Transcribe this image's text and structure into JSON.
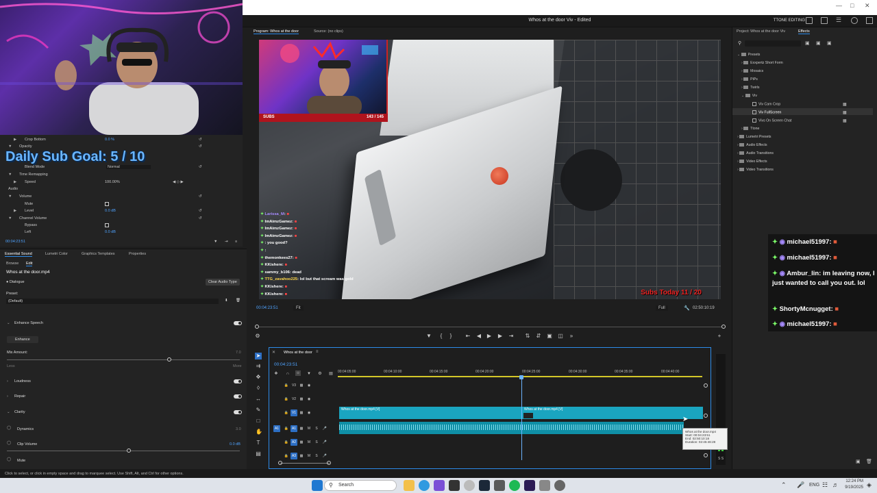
{
  "app": {
    "title": "Whos at the door Viv - Edited",
    "workspace": "TTONE EDITING"
  },
  "overlay": {
    "sub_goal": "Daily Sub Goal:  5 / 10"
  },
  "effect_controls": {
    "rows": [
      {
        "label": "Crop Bottom",
        "value": "0.0 %"
      },
      {
        "label": "Opacity",
        "value": ""
      },
      {
        "label": "Blend Mode",
        "value": "Normal"
      },
      {
        "label": "Time Remapping",
        "value": ""
      },
      {
        "label": "Speed",
        "value": "100.00%"
      },
      {
        "label": "Audio",
        "value": ""
      },
      {
        "label": "Volume",
        "value": ""
      },
      {
        "label": "Mute",
        "value": ""
      },
      {
        "label": "Level",
        "value": "0.0 dB"
      },
      {
        "label": "Channel Volume",
        "value": ""
      },
      {
        "label": "Bypass",
        "value": ""
      },
      {
        "label": "Left",
        "value": "0.0 dB"
      }
    ],
    "timecode": "00:04:23:51"
  },
  "essential_sound": {
    "tabs": [
      "Essential Sound",
      "Lumetri Color",
      "Graphics Templates",
      "Properties"
    ],
    "subtabs": [
      "Browse",
      "Edit"
    ],
    "clip_name": "Whos at the door.mp4",
    "type": "Dialogue",
    "clear_button": "Clear Audio Type",
    "preset_label": "Preset:",
    "preset_value": "(Default)",
    "enhance_speech": "Enhance Speech",
    "enhance_button": "Enhance",
    "mix_amount": "Mix Amount:",
    "mix_value": "7.0",
    "less": "Less",
    "more": "More",
    "sections": [
      "Loudness",
      "Repair",
      "Clarity"
    ],
    "dynamics": "Dynamics",
    "dynamics_value": "3.0",
    "clip_volume": "Clip Volume",
    "clip_volume_value": "0.0 dB",
    "mute": "Mute"
  },
  "status_bar": "Click to select, or click in empty space and drag to marquee select. Use Shift, Alt, and Ctrl for other options.",
  "program_monitor": {
    "tab_program": "Program: Whos at the door",
    "tab_source": "Source: (no clips)",
    "timecode": "00:04:23:51",
    "zoom": "Fit",
    "quality": "Full",
    "duration": "02:50:10:19",
    "subs_label": "SUBS",
    "subs_count": "143 / 145",
    "subs_today": "Subs Today  11 / 20",
    "chat": [
      {
        "name": "Larissa_M",
        "msg": ""
      },
      {
        "name": "ImAimzGamez",
        "msg": ""
      },
      {
        "name": "ImAimzGamez",
        "msg": ""
      },
      {
        "name": "ImAimzGamez",
        "msg": ""
      },
      {
        "name": "",
        "msg": "you good?"
      },
      {
        "name": "",
        "msg": ""
      },
      {
        "name": "themonkees27",
        "msg": ""
      },
      {
        "name": "KKishere",
        "msg": ""
      },
      {
        "name": "sammy_b106",
        "msg": "dead"
      },
      {
        "name": "TTG_zavahoo225",
        "msg": "lol but that scream was gold"
      },
      {
        "name": "KKishere",
        "msg": ""
      },
      {
        "name": "KKishere",
        "msg": ""
      }
    ]
  },
  "timeline": {
    "sequence_name": "Whos at the door",
    "timecode": "00:04:23:51",
    "ruler": [
      "00:04:05:00",
      "00:04:10:00",
      "00:04:15:00",
      "00:04:20:00",
      "00:04:25:00",
      "00:04:30:00",
      "00:04:35:00",
      "00:04:40:00"
    ],
    "video_tracks": [
      "V3",
      "V2",
      "V1"
    ],
    "audio_tracks": [
      "A1",
      "A2",
      "A3"
    ],
    "clip_label_1": "Whos at the door.mp4 [V]",
    "clip_label_2": "Whos at the door.mp4 [V]",
    "tooltip": [
      "Whos at the door.mp4",
      "Start: 00:04:23:51",
      "End: 02:50:10:18",
      "Duration: 02:45:46:28"
    ]
  },
  "project_panel": {
    "tabs": [
      "Project: Whos at the door Viv",
      "Effects"
    ],
    "tree": [
      {
        "label": "Presets",
        "indent": 0,
        "kind": "folder"
      },
      {
        "label": "Exxpertz Short Form",
        "indent": 1,
        "kind": "folder"
      },
      {
        "label": "Mosaics",
        "indent": 1,
        "kind": "folder"
      },
      {
        "label": "PiPs",
        "indent": 1,
        "kind": "folder"
      },
      {
        "label": "Twirls",
        "indent": 1,
        "kind": "folder"
      },
      {
        "label": "Viv",
        "indent": 1,
        "kind": "folder"
      },
      {
        "label": "Viv Cam Crop",
        "indent": 2,
        "kind": "fx"
      },
      {
        "label": "Viv FullScreen",
        "indent": 2,
        "kind": "fx"
      },
      {
        "label": "Vivs On Screen Chat",
        "indent": 2,
        "kind": "fx"
      },
      {
        "label": "Ttone",
        "indent": 1,
        "kind": "folder"
      },
      {
        "label": "Lumetri Presets",
        "indent": 0,
        "kind": "folder"
      },
      {
        "label": "Audio Effects",
        "indent": 0,
        "kind": "folder"
      },
      {
        "label": "Audio Transitions",
        "indent": 0,
        "kind": "folder"
      },
      {
        "label": "Video Effects",
        "indent": 0,
        "kind": "folder"
      },
      {
        "label": "Video Transitions",
        "indent": 0,
        "kind": "folder"
      }
    ]
  },
  "twitch_chat": [
    {
      "name": "michael51997",
      "msg": ""
    },
    {
      "name": "michael51997",
      "msg": ""
    },
    {
      "name": "Ambur_lin",
      "msg": "im leaving now, I just wanted to call you out. lol"
    },
    {
      "name": "ShortyMcnugget",
      "msg": ""
    },
    {
      "name": "michael51997",
      "msg": ""
    }
  ],
  "taskbar": {
    "search": "Search",
    "lang": "ENG",
    "time": "12:24 PM",
    "date": "9/19/2025"
  }
}
